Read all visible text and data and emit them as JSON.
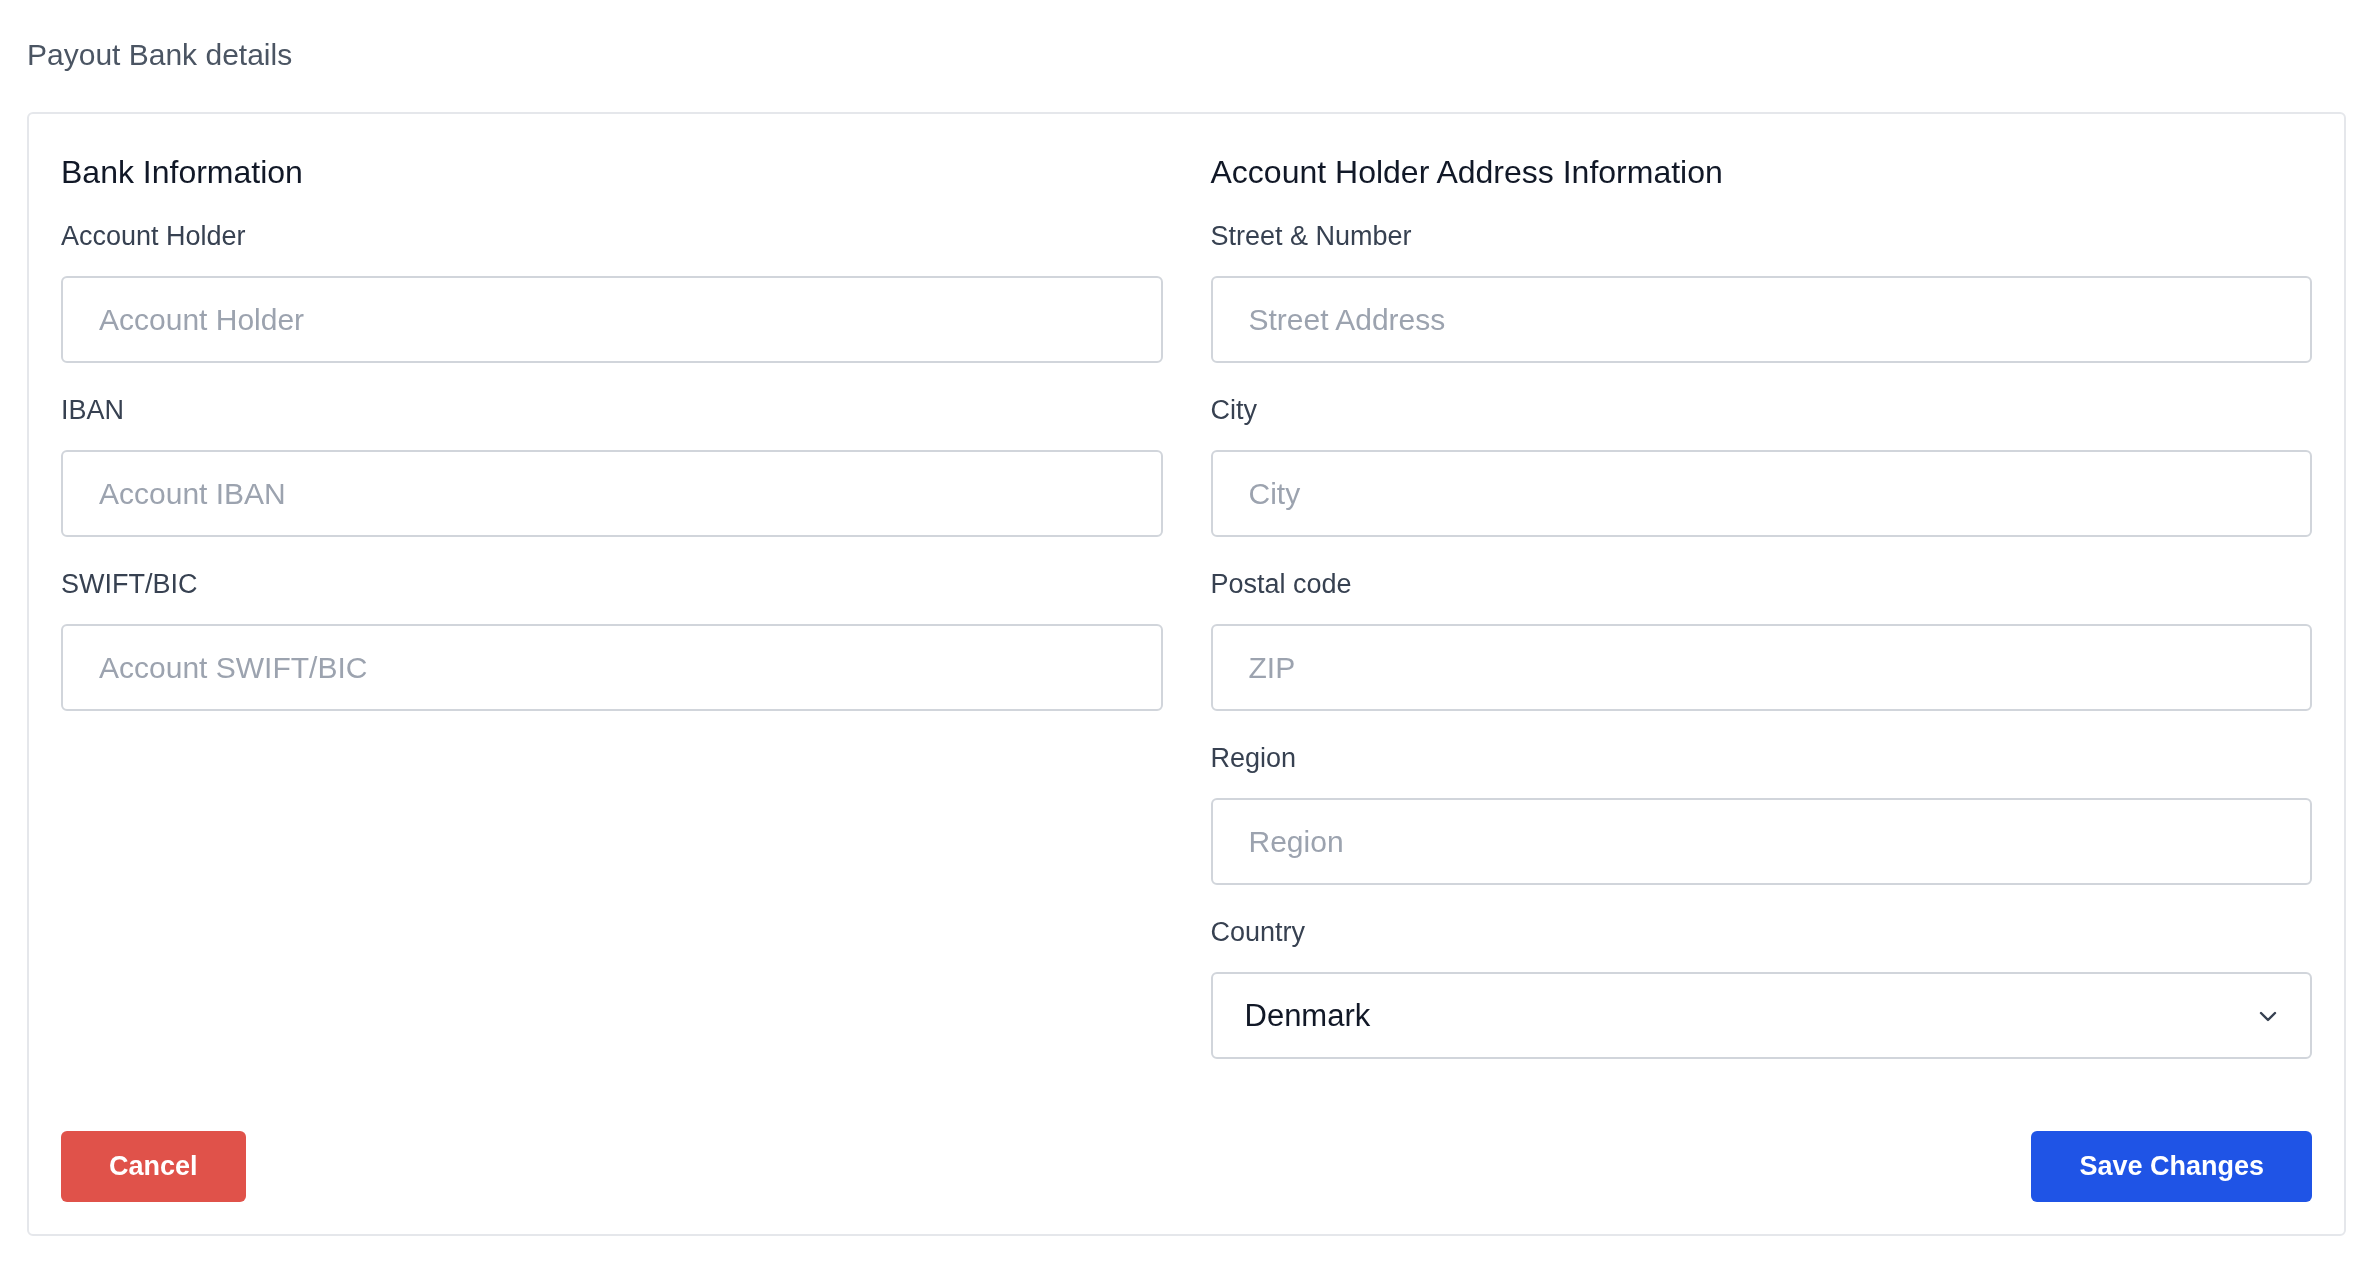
{
  "page_title": "Payout Bank details",
  "sections": [
    {
      "heading": "Bank Information",
      "fields": [
        {
          "label": "Account Holder",
          "kind": "text",
          "placeholder": "Account Holder"
        },
        {
          "label": "IBAN",
          "kind": "text",
          "placeholder": "Account IBAN"
        },
        {
          "label": "SWIFT/BIC",
          "kind": "text",
          "placeholder": "Account SWIFT/BIC"
        }
      ]
    },
    {
      "heading": "Account Holder Address Information",
      "fields": [
        {
          "label": "Street & Number",
          "kind": "text",
          "placeholder": "Street Address"
        },
        {
          "label": "City",
          "kind": "text",
          "placeholder": "City"
        },
        {
          "label": "Postal code",
          "kind": "text",
          "placeholder": "ZIP"
        },
        {
          "label": "Region",
          "kind": "text",
          "placeholder": "Region"
        },
        {
          "label": "Country",
          "kind": "select",
          "value": "Denmark"
        }
      ]
    }
  ],
  "buttons": [
    {
      "label": "Cancel",
      "kind": "danger"
    },
    {
      "label": "Save Changes",
      "kind": "primary"
    }
  ]
}
